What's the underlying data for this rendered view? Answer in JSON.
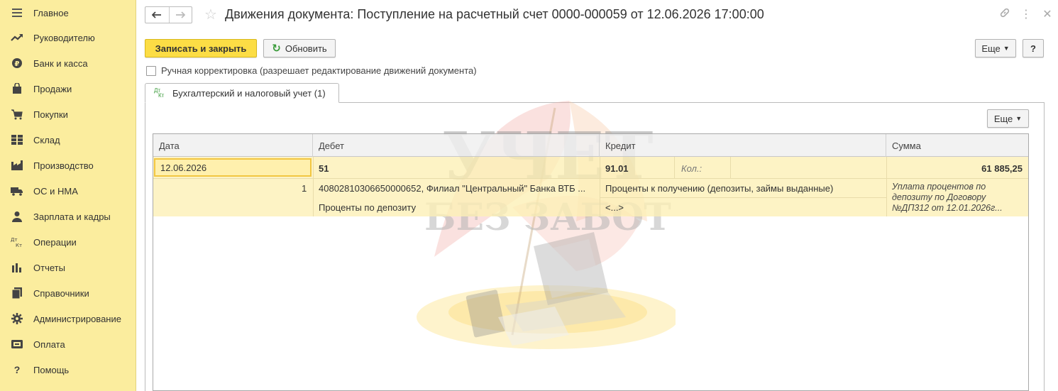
{
  "sidebar": {
    "items": [
      {
        "label": "Главное",
        "icon": "menu-icon"
      },
      {
        "label": "Руководителю",
        "icon": "trend-icon"
      },
      {
        "label": "Банк и касса",
        "icon": "ruble-icon"
      },
      {
        "label": "Продажи",
        "icon": "bag-icon"
      },
      {
        "label": "Покупки",
        "icon": "cart-icon"
      },
      {
        "label": "Склад",
        "icon": "grid-icon"
      },
      {
        "label": "Производство",
        "icon": "factory-icon"
      },
      {
        "label": "ОС и НМА",
        "icon": "truck-icon"
      },
      {
        "label": "Зарплата и кадры",
        "icon": "person-icon"
      },
      {
        "label": "Операции",
        "icon": "dt-kt-icon"
      },
      {
        "label": "Отчеты",
        "icon": "bar-chart-icon"
      },
      {
        "label": "Справочники",
        "icon": "books-icon"
      },
      {
        "label": "Администрирование",
        "icon": "gear-icon"
      },
      {
        "label": "Оплата",
        "icon": "wallet-icon"
      },
      {
        "label": "Помощь",
        "icon": "question-icon"
      }
    ]
  },
  "header": {
    "title": "Движения документа: Поступление на расчетный счет 0000-000059 от 12.06.2026 17:00:00"
  },
  "toolbar": {
    "save_close_label": "Записать и закрыть",
    "refresh_label": "Обновить",
    "more_label": "Еще",
    "help_label": "?"
  },
  "manual_correction": {
    "label": "Ручная корректировка (разрешает редактирование движений документа)",
    "checked": false
  },
  "tabs": [
    {
      "icon_text_top": "Дт",
      "icon_text_bottom": "Кт",
      "label": "Бухгалтерский и налоговый учет (1)"
    }
  ],
  "table": {
    "more_label": "Еще",
    "columns": [
      "Дата",
      "Дебет",
      "Кредит",
      "Сумма"
    ],
    "rows": [
      {
        "date": "12.06.2026",
        "number": "1",
        "debit_account": "51",
        "debit_subconto1": "40802810306650000652, Филиал \"Центральный\" Банка ВТБ ...",
        "debit_subconto2": "Проценты по депозиту",
        "credit_account": "91.01",
        "credit_qty_placeholder": "Кол.:",
        "credit_subconto1": "Проценты к получению (депозиты, займы выданные)",
        "credit_subconto2": "<...>",
        "amount": "61 885,25",
        "content": "Уплата процентов по депозиту по Договору №ДП312 от 12.01.2026г..."
      }
    ]
  },
  "watermark": {
    "line1": "УЧЕТ",
    "line2": "БЕЗ ЗАБОТ"
  },
  "colors": {
    "sidebar_bg": "#fbed9e",
    "primary_button": "#fcdd45",
    "row_highlight": "#fcefb5",
    "selected_cell_border": "#f2c641"
  }
}
